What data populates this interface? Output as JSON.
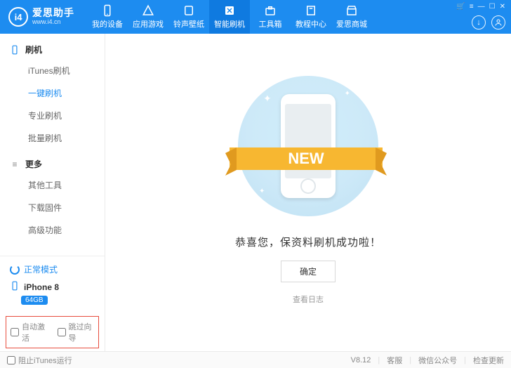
{
  "brand": {
    "logo_text": "i4",
    "name": "爱思助手",
    "url": "www.i4.cn"
  },
  "window_controls": {
    "cart": "🛒",
    "menu": "≡",
    "min": "—",
    "max": "☐",
    "close": "✕"
  },
  "header_buttons": {
    "download": "↓",
    "user": "👤"
  },
  "nav": [
    {
      "label": "我的设备",
      "icon": "phone"
    },
    {
      "label": "应用游戏",
      "icon": "apps"
    },
    {
      "label": "铃声壁纸",
      "icon": "music"
    },
    {
      "label": "智能刷机",
      "icon": "flash",
      "active": true
    },
    {
      "label": "工具箱",
      "icon": "toolbox"
    },
    {
      "label": "教程中心",
      "icon": "book"
    },
    {
      "label": "爱思商城",
      "icon": "store"
    }
  ],
  "sidebar": {
    "groups": [
      {
        "title": "刷机",
        "icon": "phone",
        "items": [
          {
            "label": "iTunes刷机"
          },
          {
            "label": "一键刷机",
            "active": true
          },
          {
            "label": "专业刷机"
          },
          {
            "label": "批量刷机"
          }
        ]
      },
      {
        "title": "更多",
        "icon": "more",
        "items": [
          {
            "label": "其他工具"
          },
          {
            "label": "下载固件"
          },
          {
            "label": "高级功能"
          }
        ]
      }
    ],
    "mode": "正常模式",
    "device": {
      "name": "iPhone 8",
      "storage": "64GB"
    },
    "checks": {
      "auto_activate": "自动激活",
      "skip_guide": "跳过向导"
    }
  },
  "main": {
    "new_label": "NEW",
    "success_text": "恭喜您，保资料刷机成功啦！",
    "ok": "确定",
    "view_log": "查看日志"
  },
  "footer": {
    "block_itunes": "阻止iTunes运行",
    "version": "V8.12",
    "support": "客服",
    "wechat": "微信公众号",
    "check_update": "检查更新"
  }
}
